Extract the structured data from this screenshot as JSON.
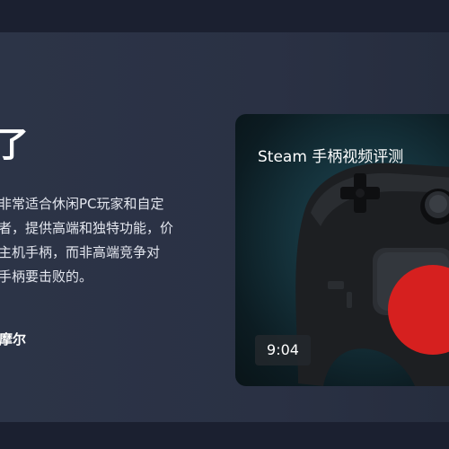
{
  "article": {
    "heading": "了",
    "body_lines": [
      "非常适合休闲PC玩家和自定",
      "者，提供高端和独特功能，价",
      "主机手柄，而非高端竞争对",
      "手柄要击败的。"
    ],
    "author": "摩尔"
  },
  "video": {
    "title": "Steam 手柄视频评测",
    "duration": "9:04"
  },
  "colors": {
    "background": "#2a3144",
    "play_button": "#d6201f"
  }
}
